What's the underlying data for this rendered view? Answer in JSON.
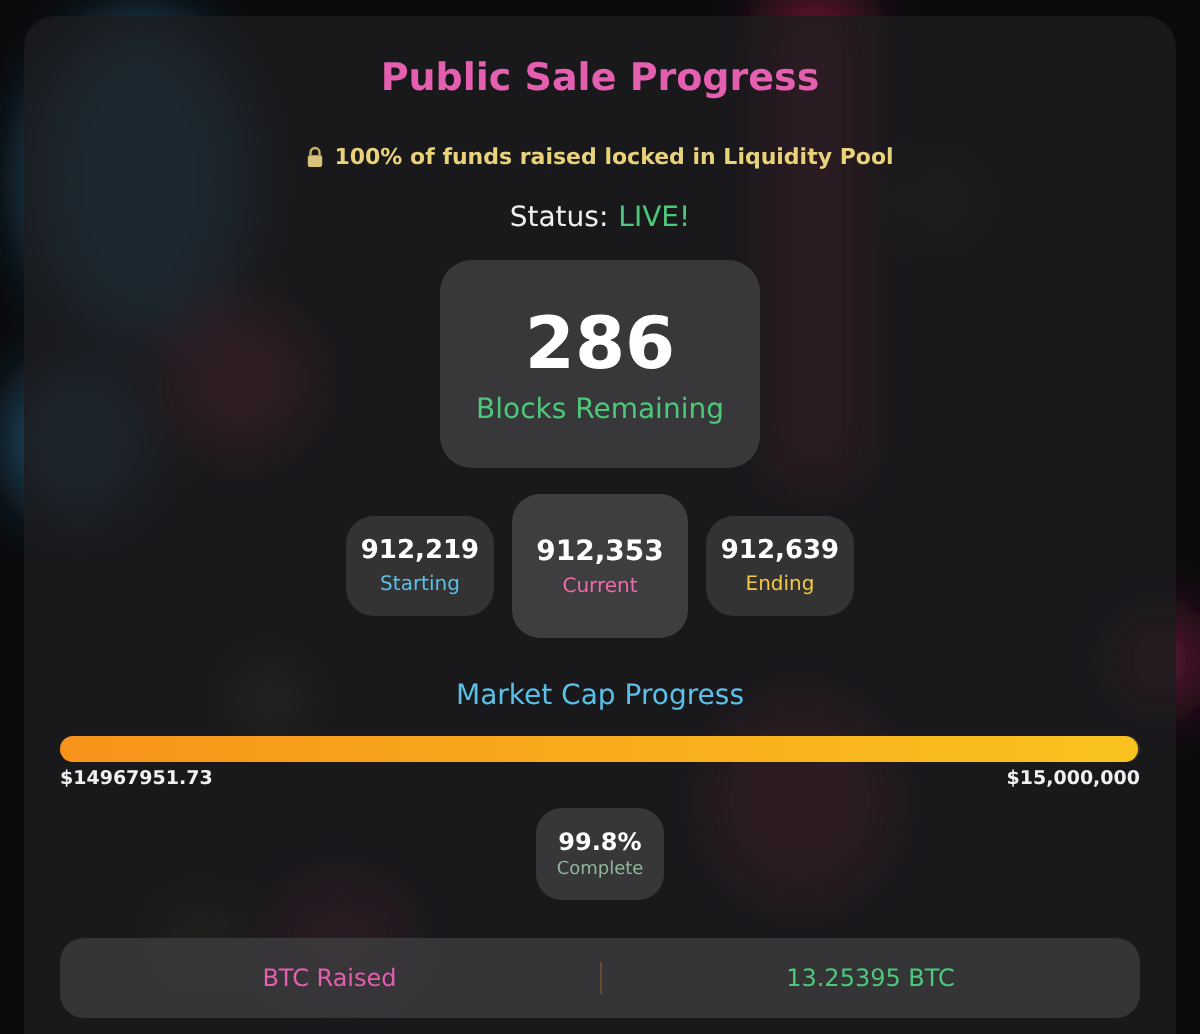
{
  "title": "Public Sale Progress",
  "lock_notice": "100% of funds raised locked in Liquidity Pool",
  "status": {
    "label": "Status:",
    "value": "LIVE!"
  },
  "blocks_remaining": {
    "value": "286",
    "label": "Blocks Remaining"
  },
  "blocks": [
    {
      "value": "912,219",
      "label": "Starting",
      "color": "#5bbfe8",
      "selected": false
    },
    {
      "value": "912,353",
      "label": "Current",
      "color": "#f06aa8",
      "selected": true
    },
    {
      "value": "912,639",
      "label": "Ending",
      "color": "#f5c842",
      "selected": false
    }
  ],
  "market_cap": {
    "title": "Market Cap Progress",
    "level": 0.998,
    "current": "$14967951.73",
    "target": "$15,000,000"
  },
  "completion": {
    "value": "99.8%",
    "label": "Complete"
  },
  "raised": {
    "label": "BTC Raised",
    "value": "13.25395 BTC"
  }
}
